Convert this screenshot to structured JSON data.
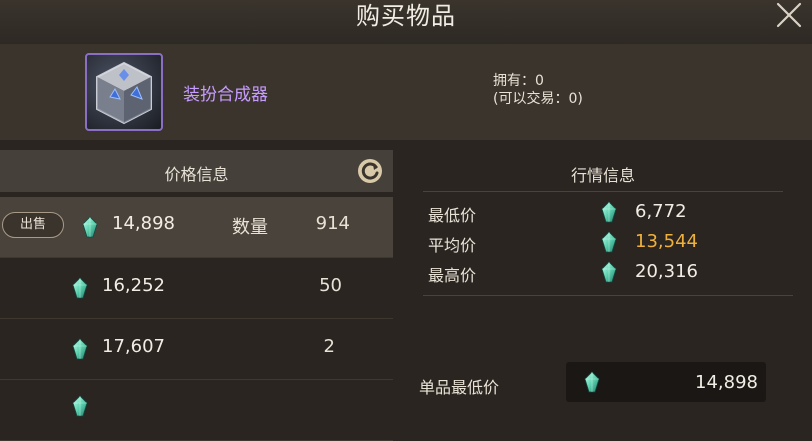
{
  "header": {
    "title": "购买物品",
    "close_icon": "close-icon"
  },
  "item": {
    "name": "装扮合成器",
    "owned_line": "拥有：0",
    "tradable_line": "(可以交易：0)",
    "name_color": "#c79cff"
  },
  "price_panel": {
    "title": "价格信息",
    "refresh_icon": "refresh-icon",
    "sell_label": "出售",
    "qty_label": "数量",
    "rows": [
      {
        "price": "14,898",
        "qty": "914"
      },
      {
        "price": "16,252",
        "qty": "50"
      },
      {
        "price": "17,607",
        "qty": "2"
      },
      {
        "price": "",
        "qty": ""
      }
    ]
  },
  "market_panel": {
    "title": "行情信息",
    "min_label": "最低价",
    "min_value": "6,772",
    "avg_label": "平均价",
    "avg_value": "13,544",
    "max_label": "最高价",
    "max_value": "20,316",
    "unit_min_label": "单品最低价",
    "unit_min_value": "14,898"
  },
  "colors": {
    "accent_gold": "#f0b13c",
    "gem": "#5fd3b0"
  }
}
